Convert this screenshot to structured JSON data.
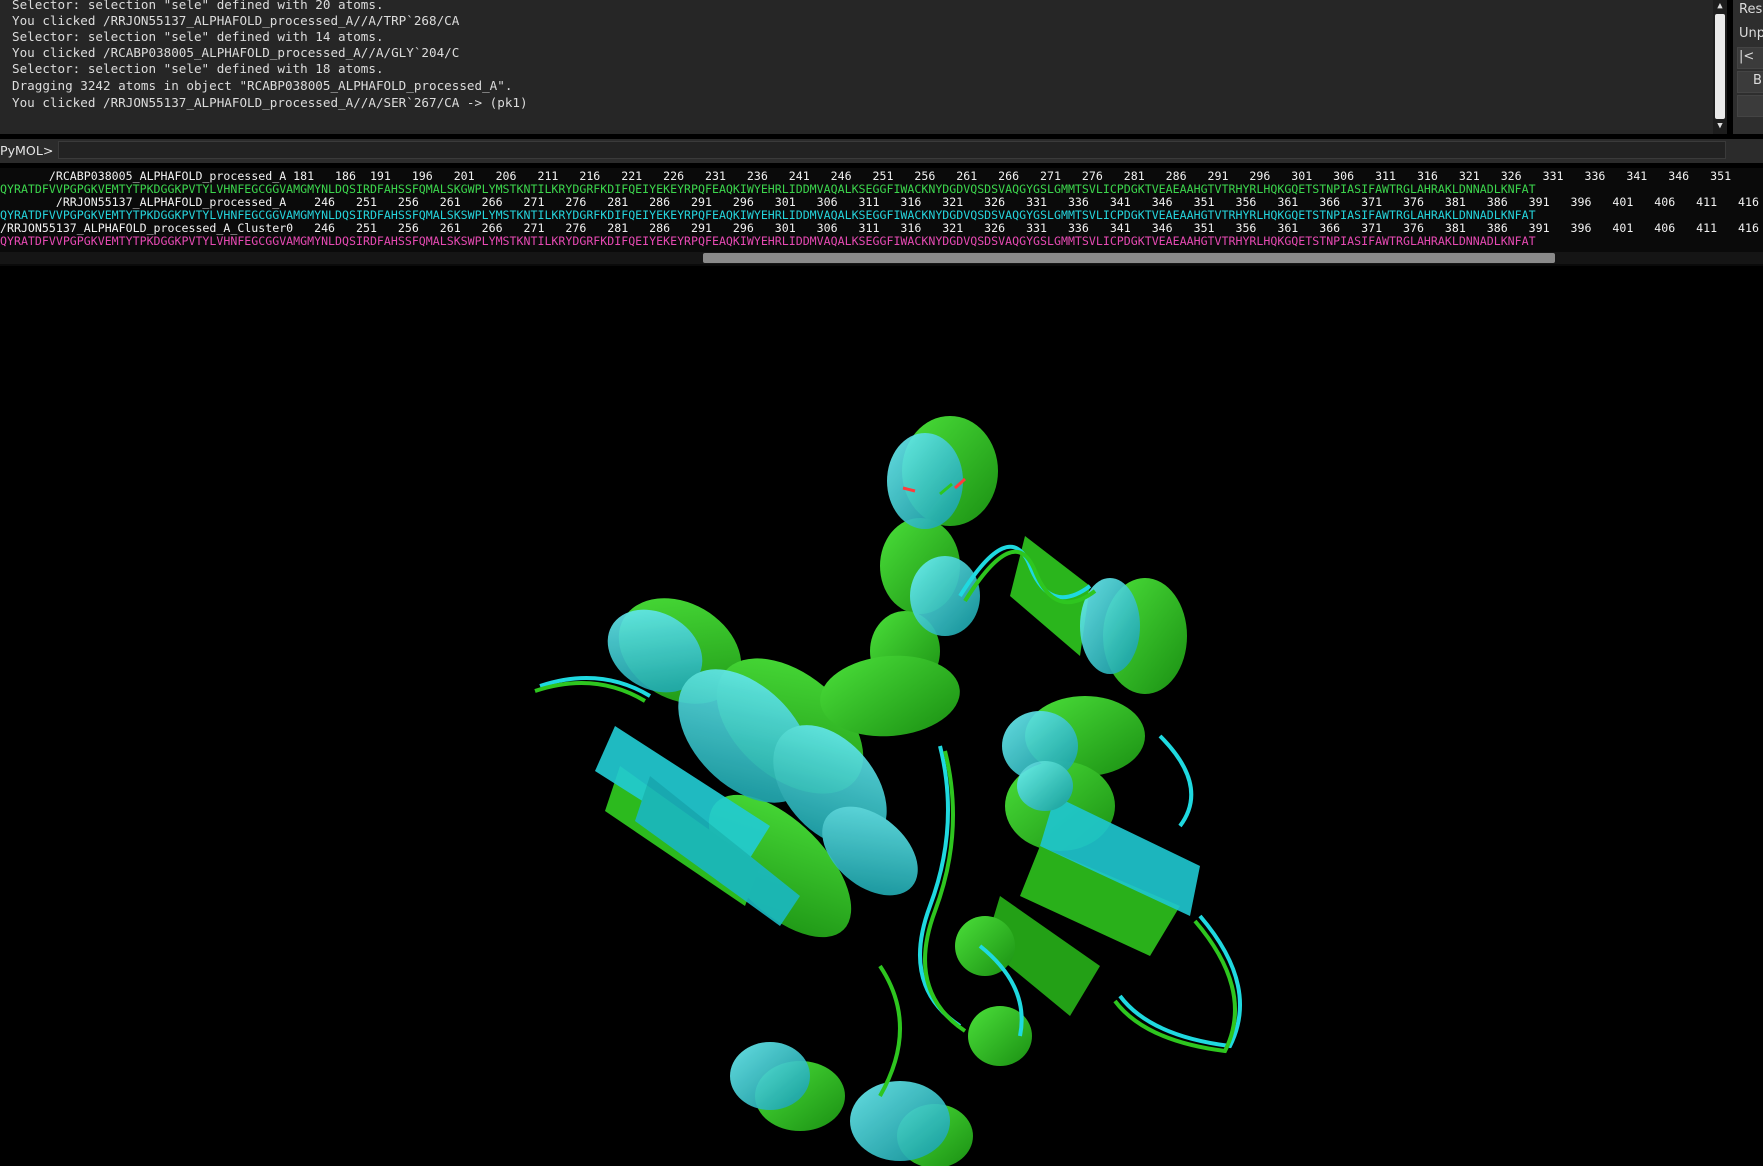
{
  "console": {
    "lines": [
      "Selector: selection \"sele\" defined with 20 atoms.",
      "You clicked /RRJON55137_ALPHAFOLD_processed_A//A/TRP`268/CA",
      "Selector: selection \"sele\" defined with 14 atoms.",
      "You clicked /RCABP038005_ALPHAFOLD_processed_A//A/GLY`204/C",
      "Selector: selection \"sele\" defined with 18 atoms.",
      "Dragging 3242 atoms in object \"RCABP038005_ALPHAFOLD_processed_A\".",
      "You clicked /RRJON55137_ALPHAFOLD_processed_A//A/SER`267/CA -> (pk1)"
    ]
  },
  "side_panel": {
    "items": [
      "Res",
      "Unp",
      "|<",
      "B"
    ]
  },
  "command_line": {
    "prompt": "PyMOL>",
    "value": ""
  },
  "sequence_viewer": {
    "rows": [
      {
        "kind": "hdr",
        "text": "       /RCABP038005_ALPHAFOLD_processed_A 181   186  191   196   201   206   211   216   221   226   231   236   241   246   251   256   261   266   271   276   281   286   291   296   301   306   311   316   321   326   331   336   341   346   351"
      },
      {
        "kind": "green",
        "text": "QYRATDFVVPGPGKVEMTYTPKDGGKPVTYLVHNFEGCGGVAMGMYNLDQSIRDFAHSSFQMALSKGWPLYMSTKNTILKRYDGRFKDIFQEIYEKEYRPQFEAQKIWYEHRLIDDMVAQALKSEGGFIWACKNYDGDVQSDSVAQGYGSLGMMTSVLICPDGKTVEAEAAHGTVTRHYRLHQKGQETSTNPIASIFAWTRGLAHRAKLDNNADLKNFAT"
      },
      {
        "kind": "hdr",
        "text": "        /RRJON55137_ALPHAFOLD_processed_A    246   251   256   261   266   271   276   281   286   291   296   301   306   311   316   321   326   331   336   341   346   351   356   361   366   371   376   381   386   391   396   401   406   411   416"
      },
      {
        "kind": "cyan",
        "text": "QYRATDFVVPGPGKVEMTYTPKDGGKPVTYLVHNFEGCGGVAMGMYNLDQSIRDFAHSSFQMALSKSWPLYMSTKNTILKRYDGRFKDIFQEIYEKEYRPQFEAQKIWYEHRLIDDMVAQALKSEGGFIWACKNYDGDVQSDSVAQGYGSLGMMTSVLICPDGKTVEAEAAHGTVTRHYRLHQKGQETSTNPIASIFAWTRGLAHRAKLDNNADLKNFAT"
      },
      {
        "kind": "hdr",
        "text": "/RRJON55137_ALPHAFOLD_processed_A_Cluster0   246   251   256   261   266   271   276   281   286   291   296   301   306   311   316   321   326   331   336   341   346   351   356   361   366   371   376   381   386   391   396   401   406   411   416"
      },
      {
        "kind": "magenta",
        "text": "QYRATDFVVPGPGKVEMTYTPKDGGKPVTYLVHNFEGCGGVAMGMYNLDQSIRDFAHSSFQMALSKSWPLYMSTKNTILKRYDGRFKDIFQEIYEKEYRPQFEAQKIWYEHRLIDDMVAQALKSEGGFIWACKNYDGDVQSDSVAQGYGSLGMMTSVLICPDGKTVEAEAAHGTVTRHYRLHQKGQETSTNPIASIFAWTRGLAHRAKLDNNADLKNFAT"
      }
    ]
  },
  "viewport": {
    "colors": {
      "structure_a": "#2ec61f",
      "structure_b": "#1fd9e0",
      "background": "#000000"
    }
  }
}
